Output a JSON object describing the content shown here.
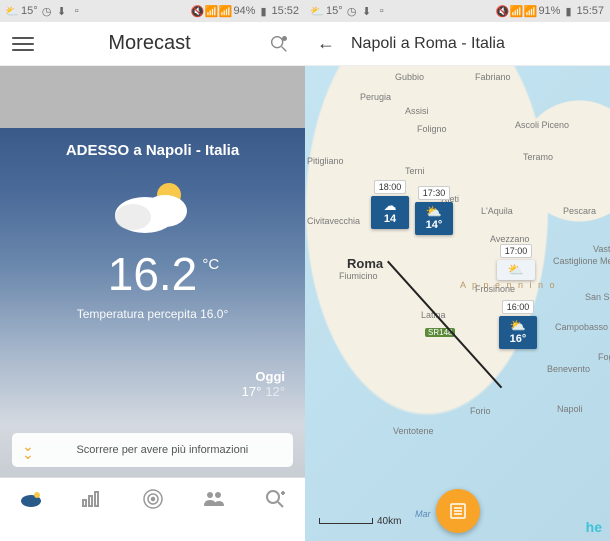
{
  "phone1": {
    "status": {
      "temp": "15°",
      "battery": "94%",
      "time": "15:52"
    },
    "app_title": "Morecast",
    "location_now": "ADESSO a Napoli - Italia",
    "temp": "16.2",
    "temp_unit": "°C",
    "feels": "Temperatura percepita 16.0°",
    "today_label": "Oggi",
    "today_hi": "17°",
    "today_lo": "12°",
    "scroll_hint": "Scorrere per avere più informazioni"
  },
  "phone2": {
    "status": {
      "temp": "15°",
      "battery": "91%",
      "time": "15:57"
    },
    "route_title": "Napoli a Roma - Italia",
    "cities": {
      "gubbio": "Gubbio",
      "fabriano": "Fabriano",
      "perugia": "Perugia",
      "assisi": "Assisi",
      "foligno": "Foligno",
      "ascoli": "Ascoli Piceno",
      "pitigliano": "Pitigliano",
      "teramo": "Teramo",
      "terni": "Terni",
      "rieti": "Rieti",
      "laquila": "L'Aquila",
      "civitavecchia": "Civitavecchia",
      "pescara": "Pescara",
      "avezzano": "Avezzano",
      "vasto": "Vasto",
      "fiumicino": "Fiumicino",
      "frosinone": "Frosinone",
      "sansevero": "San Severo",
      "castiglione": "Castiglione Messer Marino",
      "latina": "Latina",
      "apennines": "A p p e n n i n o",
      "campobasso": "Campobasso",
      "benevento": "Benevento",
      "foggia": "Foggia",
      "forio": "Forio",
      "napoli": "Napoli",
      "ventotene": "Ventotene",
      "sr148": "SR148",
      "mar": "Mar"
    },
    "roma": "Roma",
    "pins": [
      {
        "time": "18:00",
        "temp": "14",
        "light": false
      },
      {
        "time": "17:30",
        "temp": "14°",
        "light": false
      },
      {
        "time": "17:00",
        "temp": "",
        "light": true
      },
      {
        "time": "16:00",
        "temp": "16°",
        "light": false
      }
    ],
    "scale": "40km",
    "here": "he"
  }
}
